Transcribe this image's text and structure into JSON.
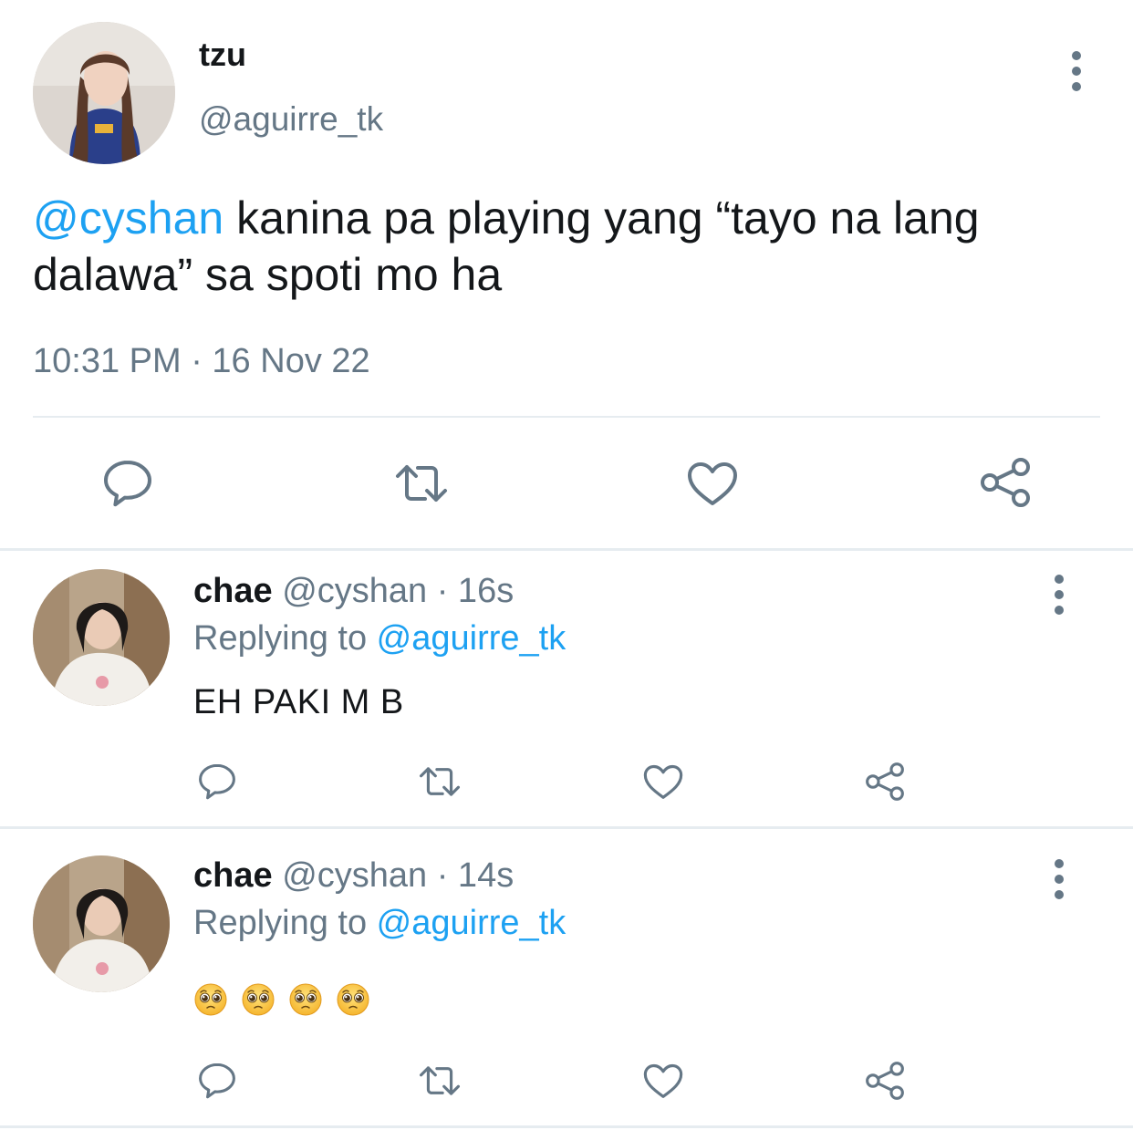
{
  "main_tweet": {
    "display_name": "tzu",
    "handle": "@aguirre_tk",
    "mention": "@cyshan",
    "text": " kanina pa playing yang “tayo na lang dalawa” sa spoti mo ha",
    "timestamp": "10:31 PM · 16 Nov 22",
    "avatar_icon": "profile-photo"
  },
  "replies": [
    {
      "display_name": "chae",
      "meta": "@cyshan · 16s",
      "replying_label": "Replying to ",
      "replying_handle": "@aguirre_tk",
      "text": "EH PAKI M B",
      "emoji_count": 0
    },
    {
      "display_name": "chae",
      "meta": "@cyshan · 14s",
      "replying_label": "Replying to ",
      "replying_handle": "@aguirre_tk",
      "text": "",
      "emoji_name": "pleading-face-emoji",
      "emoji_count": 4
    }
  ],
  "icons": {
    "reply": "reply-icon",
    "retweet": "retweet-icon",
    "like": "heart-icon",
    "share": "share-icon",
    "more": "more-vertical-icon"
  },
  "colors": {
    "text": "#14171a",
    "muted": "#657786",
    "link": "#1da1f2",
    "divider": "#e6ecf0"
  }
}
